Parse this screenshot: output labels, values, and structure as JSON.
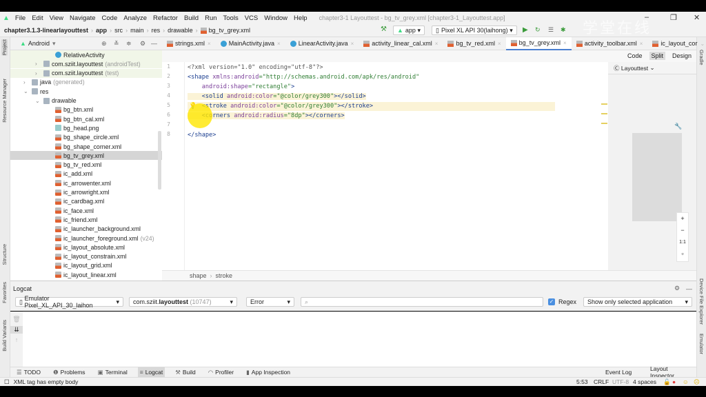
{
  "menu": {
    "items": [
      "File",
      "Edit",
      "View",
      "Navigate",
      "Code",
      "Analyze",
      "Refactor",
      "Build",
      "Run",
      "Tools",
      "VCS",
      "Window",
      "Help"
    ],
    "window_title": "chapter3-1 Layouttest - bg_tv_grey.xml [chapter3-1_Layouttest.app]"
  },
  "nav": {
    "crumbs": [
      "chapter3.1.3-linearlayouttest",
      "app",
      "src",
      "main",
      "res",
      "drawable",
      "bg_tv_grey.xml"
    ],
    "run_config": "app",
    "device": "Pixel XL API 30(laihong)"
  },
  "watermark": "学堂在线",
  "project": {
    "view": "Android",
    "tree": [
      {
        "label": "RelativeActivity",
        "depth": 3,
        "icon": "java",
        "hint": ""
      },
      {
        "label": "com.sziit.layouttest",
        "depth": 2,
        "icon": "folder",
        "hint": "(androidTest)",
        "arrow": ">"
      },
      {
        "label": "com.sziit.layouttest",
        "depth": 2,
        "icon": "folder",
        "hint": "(test)",
        "arrow": ">"
      },
      {
        "label": "java",
        "depth": 1,
        "icon": "folder",
        "hint": "(generated)",
        "arrow": ">"
      },
      {
        "label": "res",
        "depth": 1,
        "icon": "folder",
        "hint": "",
        "arrow": "v"
      },
      {
        "label": "drawable",
        "depth": 2,
        "icon": "folder",
        "hint": "",
        "arrow": "v"
      },
      {
        "label": "bg_btn.xml",
        "depth": 3,
        "icon": "xml",
        "hint": ""
      },
      {
        "label": "bg_btn_cal.xml",
        "depth": 3,
        "icon": "xml",
        "hint": ""
      },
      {
        "label": "bg_head.png",
        "depth": 3,
        "icon": "png",
        "hint": ""
      },
      {
        "label": "bg_shape_circle.xml",
        "depth": 3,
        "icon": "xml",
        "hint": ""
      },
      {
        "label": "bg_shape_corner.xml",
        "depth": 3,
        "icon": "xml",
        "hint": ""
      },
      {
        "label": "bg_tv_grey.xml",
        "depth": 3,
        "icon": "xml",
        "hint": "",
        "selected": true
      },
      {
        "label": "bg_tv_red.xml",
        "depth": 3,
        "icon": "xml",
        "hint": ""
      },
      {
        "label": "ic_add.xml",
        "depth": 3,
        "icon": "xml",
        "hint": ""
      },
      {
        "label": "ic_arrowenter.xml",
        "depth": 3,
        "icon": "xml",
        "hint": ""
      },
      {
        "label": "ic_arrowright.xml",
        "depth": 3,
        "icon": "xml",
        "hint": ""
      },
      {
        "label": "ic_cardbag.xml",
        "depth": 3,
        "icon": "xml",
        "hint": ""
      },
      {
        "label": "ic_face.xml",
        "depth": 3,
        "icon": "xml",
        "hint": ""
      },
      {
        "label": "ic_friend.xml",
        "depth": 3,
        "icon": "xml",
        "hint": ""
      },
      {
        "label": "ic_launcher_background.xml",
        "depth": 3,
        "icon": "xml",
        "hint": ""
      },
      {
        "label": "ic_launcher_foreground.xml",
        "depth": 3,
        "icon": "xml",
        "hint": "(v24)"
      },
      {
        "label": "ic_layout_absolute.xml",
        "depth": 3,
        "icon": "xml",
        "hint": ""
      },
      {
        "label": "ic_layout_constrain.xml",
        "depth": 3,
        "icon": "xml",
        "hint": ""
      },
      {
        "label": "ic_layout_grid.xml",
        "depth": 3,
        "icon": "xml",
        "hint": ""
      },
      {
        "label": "ic_layout_linear.xml",
        "depth": 3,
        "icon": "xml",
        "hint": ""
      }
    ]
  },
  "side_tools": {
    "project": "Project",
    "resource_manager": "Resource Manager",
    "structure": "Structure",
    "favorites": "Favorites",
    "build_variants": "Build Variants",
    "gradle": "Gradle",
    "device_file_explorer": "Device File Explorer",
    "emulator": "Emulator"
  },
  "tabs": [
    {
      "label": "strings.xml",
      "icon": "xml"
    },
    {
      "label": "MainActivity.java",
      "icon": "java"
    },
    {
      "label": "LinearActivity.java",
      "icon": "java"
    },
    {
      "label": "activity_linear_cal.xml",
      "icon": "xml"
    },
    {
      "label": "bg_tv_red.xml",
      "icon": "xml"
    },
    {
      "label": "bg_tv_grey.xml",
      "icon": "xml",
      "active": true
    },
    {
      "label": "activity_toolbar.xml",
      "icon": "xml"
    },
    {
      "label": "ic_layout_cor",
      "icon": "xml"
    }
  ],
  "editor": {
    "modes": [
      "Code",
      "Split",
      "Design"
    ],
    "active_mode": "Split",
    "warnings": "3",
    "preview_theme": "Layouttest",
    "lines": [
      [
        {
          "t": "<?xml version=\"1.0\" encoding=\"utf-8\"?>",
          "c": "pi"
        }
      ],
      [
        {
          "t": "<shape ",
          "c": "tag"
        },
        {
          "t": "xmlns:android",
          "c": "attr"
        },
        {
          "t": "=\"http://schemas.android.com/apk/res/android\"",
          "c": "val"
        }
      ],
      [
        {
          "t": "    android:shape",
          "c": "attr"
        },
        {
          "t": "=\"rectangle\"",
          "c": "val"
        },
        {
          "t": ">",
          "c": "tag"
        }
      ],
      [
        {
          "t": "    <solid ",
          "c": "tag"
        },
        {
          "t": "android:color",
          "c": "attr"
        },
        {
          "t": "=\"@color/grey300\"",
          "c": "val"
        },
        {
          "t": "></solid>",
          "c": "tag"
        }
      ],
      [
        {
          "t": "    <stroke ",
          "c": "tag"
        },
        {
          "t": "android:color",
          "c": "attr"
        },
        {
          "t": "=\"@color/grey300\"",
          "c": "val"
        },
        {
          "t": "></stroke>",
          "c": "tag"
        }
      ],
      [
        {
          "t": "    <corners ",
          "c": "tag"
        },
        {
          "t": "android:radius",
          "c": "attr"
        },
        {
          "t": "=\"8dp\"",
          "c": "val"
        },
        {
          "t": "></corners>",
          "c": "tag"
        }
      ],
      [
        {
          "t": "",
          "c": "tag"
        }
      ],
      [
        {
          "t": "</shape>",
          "c": "tag"
        }
      ]
    ],
    "breadcrumb": [
      "shape",
      "stroke"
    ]
  },
  "logcat": {
    "title": "Logcat",
    "device": "Emulator Pixel_XL_API_30_laihon",
    "process_prefix": "com.sziit.",
    "process_bold": "layouttest",
    "pid": "(10747)",
    "level": "Error",
    "search_placeholder": "",
    "regex_label": "Regex",
    "regex_checked": true,
    "filter": "Show only selected application"
  },
  "bottom_tabs": [
    "TODO",
    "Problems",
    "Terminal",
    "Logcat",
    "Build",
    "Profiler",
    "App Inspection"
  ],
  "bottom_right": [
    "Event Log",
    "Layout Inspector"
  ],
  "status": {
    "message": "XML tag has empty body",
    "position": "5:53",
    "line_sep": "CRLF",
    "encoding": "UTF-8",
    "indent": "4 spaces"
  },
  "colors": {
    "accent": "#4a7fd0",
    "line_highlight": "#fbf3d6",
    "run_green": "#3a9b3a"
  }
}
